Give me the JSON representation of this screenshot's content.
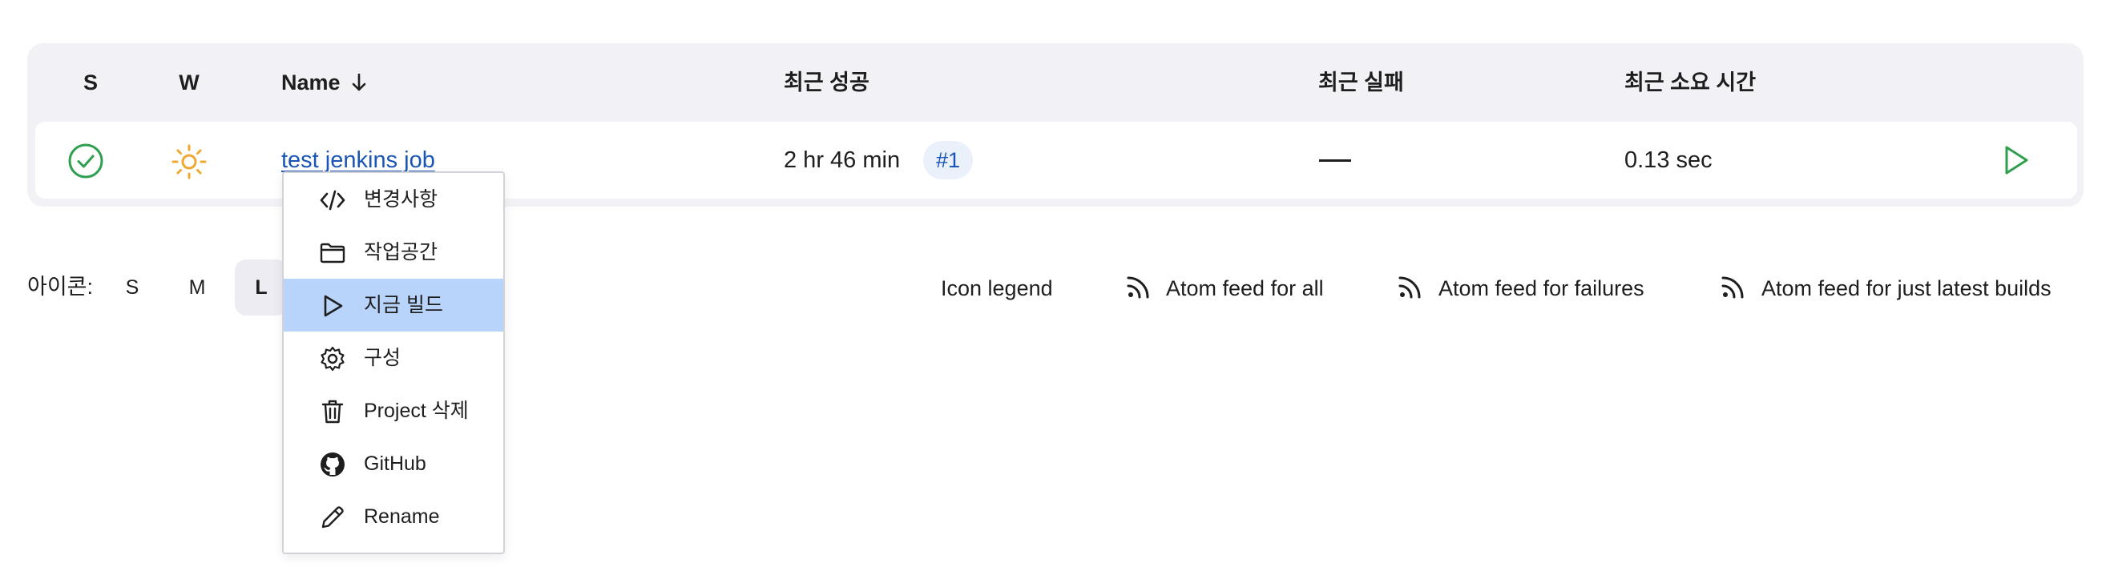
{
  "columns": {
    "status": "S",
    "weather": "W",
    "name": "Name",
    "last_success": "최근 성공",
    "last_failure": "최근 실패",
    "last_duration": "최근 소요 시간"
  },
  "job": {
    "name": "test jenkins job",
    "last_success_time": "2 hr 46 min",
    "last_success_build": "#1",
    "last_failure": "—",
    "last_duration": "0.13 sec",
    "status_color": "#2e9e4f",
    "weather_color": "#f0a830",
    "run_color": "#2e9e4f"
  },
  "icon_size": {
    "label": "아이콘:",
    "options": [
      "S",
      "M",
      "L"
    ],
    "selected": "L"
  },
  "footer_links": {
    "legend": "Icon legend",
    "feed_all": "Atom feed for all",
    "feed_failures": "Atom feed for failures",
    "feed_latest": "Atom feed for just latest builds"
  },
  "context_menu": {
    "items": [
      {
        "label": "변경사항",
        "icon": "code-icon"
      },
      {
        "label": "작업공간",
        "icon": "folder-icon"
      },
      {
        "label": "지금 빌드",
        "icon": "play-icon"
      },
      {
        "label": "구성",
        "icon": "gear-icon"
      },
      {
        "label": "Project 삭제",
        "icon": "trash-icon"
      },
      {
        "label": "GitHub",
        "icon": "github-icon"
      },
      {
        "label": "Rename",
        "icon": "pencil-icon"
      }
    ],
    "highlighted_index": 2,
    "highlight_color": "#b9d4fb"
  }
}
